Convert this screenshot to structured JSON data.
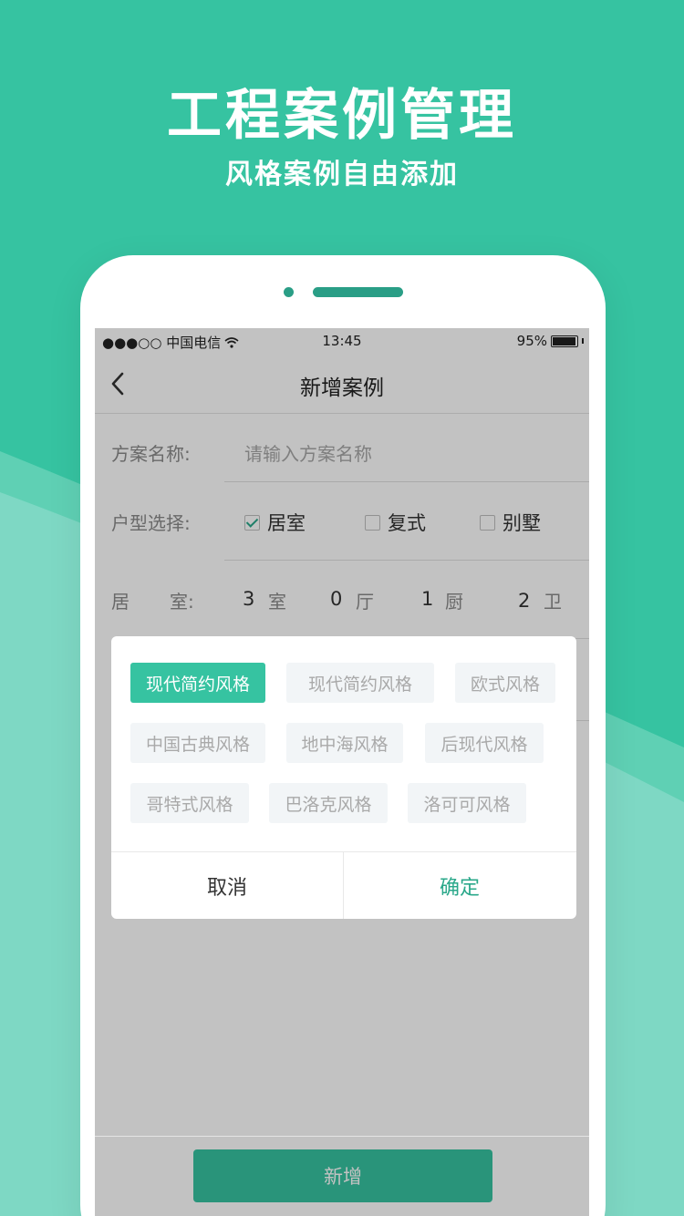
{
  "promo": {
    "title": "工程案例管理",
    "subtitle": "风格案例自由添加"
  },
  "status_bar": {
    "carrier": "●●●○○ 中国电信",
    "time": "13:45",
    "battery": "95%"
  },
  "nav": {
    "title": "新增案例"
  },
  "form": {
    "plan_name_label": "方案名称:",
    "plan_name_placeholder": "请输入方案名称",
    "house_type_label": "户型选择:",
    "house_types": [
      {
        "label": "居室",
        "checked": true
      },
      {
        "label": "复式",
        "checked": false
      },
      {
        "label": "别墅",
        "checked": false
      }
    ],
    "rooms_label_1": "居",
    "rooms_label_2": "室:",
    "rooms": [
      {
        "value": "3",
        "unit": "室"
      },
      {
        "value": "0",
        "unit": "厅"
      },
      {
        "value": "1",
        "unit": "厨"
      },
      {
        "value": "2",
        "unit": "卫"
      }
    ]
  },
  "footer": {
    "add_label": "新增"
  },
  "style_dialog": {
    "tags": [
      {
        "label": "现代简约风格",
        "active": true
      },
      {
        "label": "现代简约风格",
        "active": false
      },
      {
        "label": "欧式风格",
        "active": false
      },
      {
        "label": "中国古典风格",
        "active": false
      },
      {
        "label": "地中海风格",
        "active": false
      },
      {
        "label": "后现代风格",
        "active": false
      },
      {
        "label": "哥特式风格",
        "active": false
      },
      {
        "label": "巴洛克风格",
        "active": false
      },
      {
        "label": "洛可可风格",
        "active": false
      }
    ],
    "cancel_label": "取消",
    "confirm_label": "确定"
  },
  "colors": {
    "brand": "#36c3a1",
    "confirm_text": "#2aa88a",
    "cancel_text": "#333333"
  }
}
